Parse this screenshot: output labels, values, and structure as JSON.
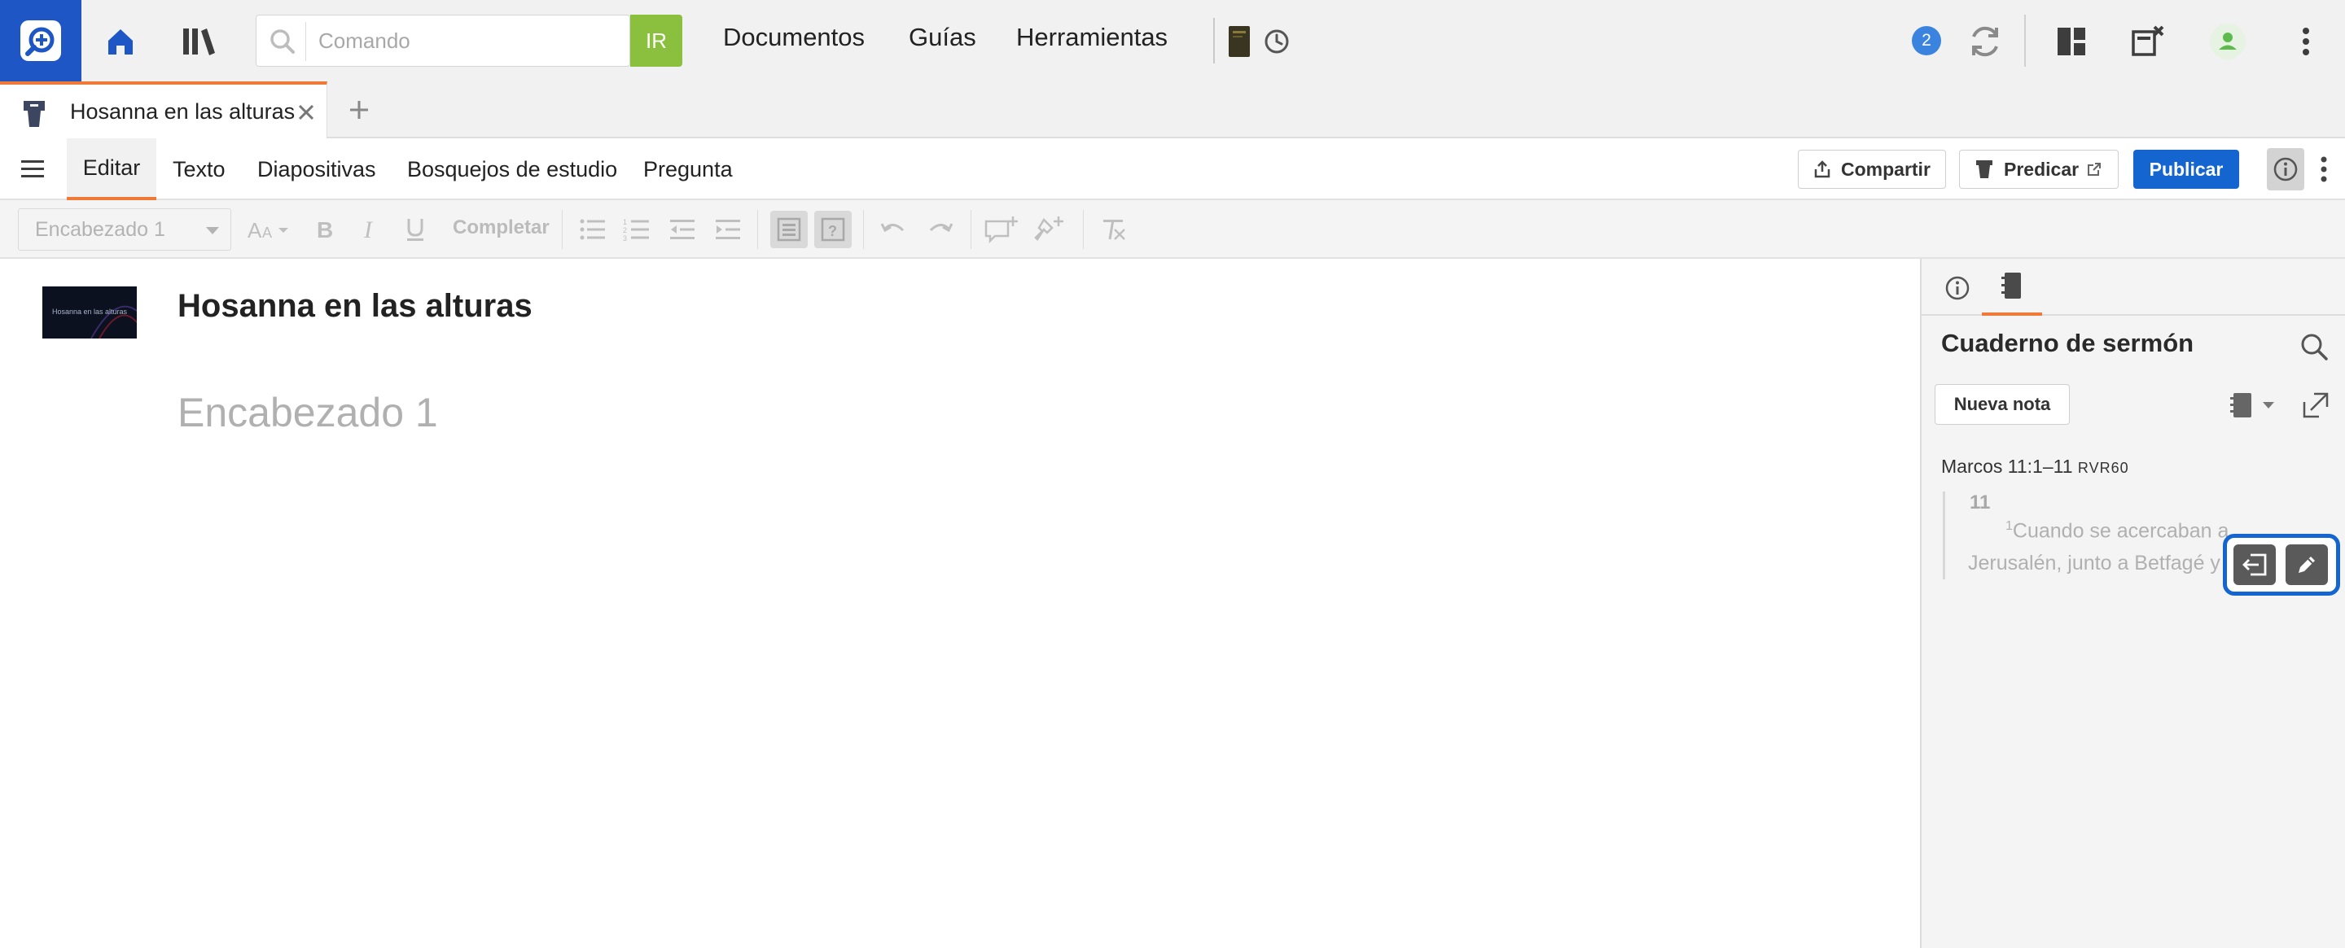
{
  "topbar": {
    "search": {
      "placeholder": "Comando",
      "value": ""
    },
    "go_label": "IR",
    "nav": {
      "documents": "Documentos",
      "guides": "Guías",
      "tools": "Herramientas"
    },
    "sync_badge": "2",
    "icons": [
      "logos-app-icon",
      "home-icon",
      "library-icon",
      "search-icon",
      "book-icon",
      "history-icon",
      "sync-icon",
      "layouts-icon",
      "close-panels-icon",
      "user-icon",
      "kebab-icon"
    ]
  },
  "tabs": [
    {
      "label": "Hosanna en las alturas",
      "icon": "sermon-icon",
      "active": true
    }
  ],
  "menubar": {
    "items": [
      "Editar",
      "Texto",
      "Diapositivas",
      "Bosquejos de estudio",
      "Pregunta"
    ],
    "active": "Editar",
    "share_label": "Compartir",
    "preach_label": "Predicar",
    "publish_label": "Publicar"
  },
  "toolbar": {
    "style_select": "Encabezado 1",
    "complete_label": "Completar"
  },
  "editor": {
    "thumbnail_caption": "Hosanna en las alturas",
    "title": "Hosanna en las alturas",
    "heading_placeholder": "Encabezado 1"
  },
  "sidepanel": {
    "title": "Cuaderno de sermón",
    "new_note_label": "Nueva nota",
    "note": {
      "reference": "Marcos 11:1–11",
      "version": "RVR60",
      "chapter": "11",
      "verse_number": "1",
      "line1": "Cuando se acercaban a",
      "line2": "Jerusalén, junto a Betfagé y"
    }
  },
  "colors": {
    "brand_blue": "#1e56c6",
    "accent_orange": "#ef7a37",
    "go_green": "#8ac03d",
    "publish_blue": "#1565d0",
    "badge_blue": "#3a84e0",
    "user_green": "#5dbb4e"
  }
}
